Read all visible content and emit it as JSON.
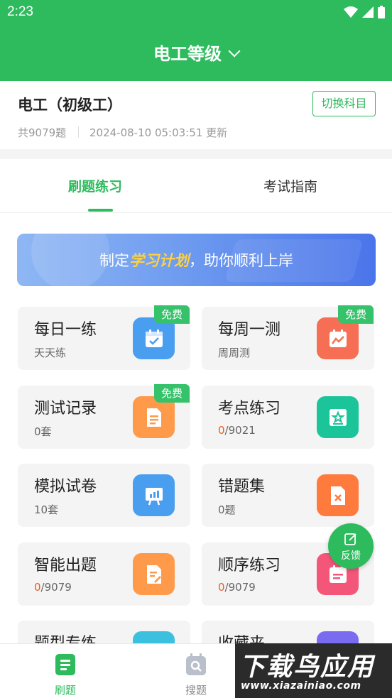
{
  "status_bar": {
    "time": "2:23"
  },
  "header": {
    "title": "电工等级"
  },
  "subject": {
    "name": "电工（初级工）",
    "count": "共9079题",
    "updated": "2024-08-10 05:03:51 更新",
    "switch_label": "切换科目"
  },
  "tabs": [
    {
      "label": "刷题练习",
      "active": true
    },
    {
      "label": "考试指南",
      "active": false
    }
  ],
  "banner": {
    "prefix": "制定",
    "highlight": "学习计划",
    "suffix": "，助你顺利上岸"
  },
  "cards": [
    {
      "title": "每日一练",
      "sub": "天天练",
      "badge": "免费",
      "icon": "calendar-check-icon",
      "color": "#4a9ef0"
    },
    {
      "title": "每周一测",
      "sub": "周周测",
      "badge": "免费",
      "icon": "calendar-chart-icon",
      "color": "#f66f55"
    },
    {
      "title": "测试记录",
      "sub": "0套",
      "badge": "免费",
      "icon": "document-icon",
      "color": "#ff9a4a"
    },
    {
      "title": "考点练习",
      "sub_done": "0",
      "sub_total": "/9021",
      "icon": "star-board-icon",
      "color": "#1cc49a"
    },
    {
      "title": "模拟试卷",
      "sub": "10套",
      "icon": "presentation-chart-icon",
      "color": "#4a9ef0"
    },
    {
      "title": "错题集",
      "sub": "0题",
      "icon": "wrong-doc-icon",
      "color": "#ff7a3d"
    },
    {
      "title": "智能出题",
      "sub_done": "0",
      "sub_total": "/9079",
      "icon": "edit-doc-icon",
      "color": "#ff9a4a"
    },
    {
      "title": "顺序练习",
      "sub_done": "0",
      "sub_total": "/9079",
      "icon": "list-calendar-icon",
      "color": "#f4567a"
    },
    {
      "title": "题型专练",
      "icon": "type-icon",
      "color": "#3cc0e0"
    },
    {
      "title": "收藏夹",
      "icon": "bookmark-icon",
      "color": "#7a6cf0"
    }
  ],
  "feedback": {
    "label": "反馈"
  },
  "bottom_nav": [
    {
      "label": "刷题",
      "active": true,
      "icon": "doc-list-icon"
    },
    {
      "label": "搜题",
      "active": false,
      "icon": "search-calendar-icon"
    }
  ],
  "watermark": {
    "title": "下载鸟应用",
    "url": "www.xiazainiao.com"
  },
  "colors": {
    "primary": "#2dbb5d",
    "highlight": "#f05a1a"
  }
}
